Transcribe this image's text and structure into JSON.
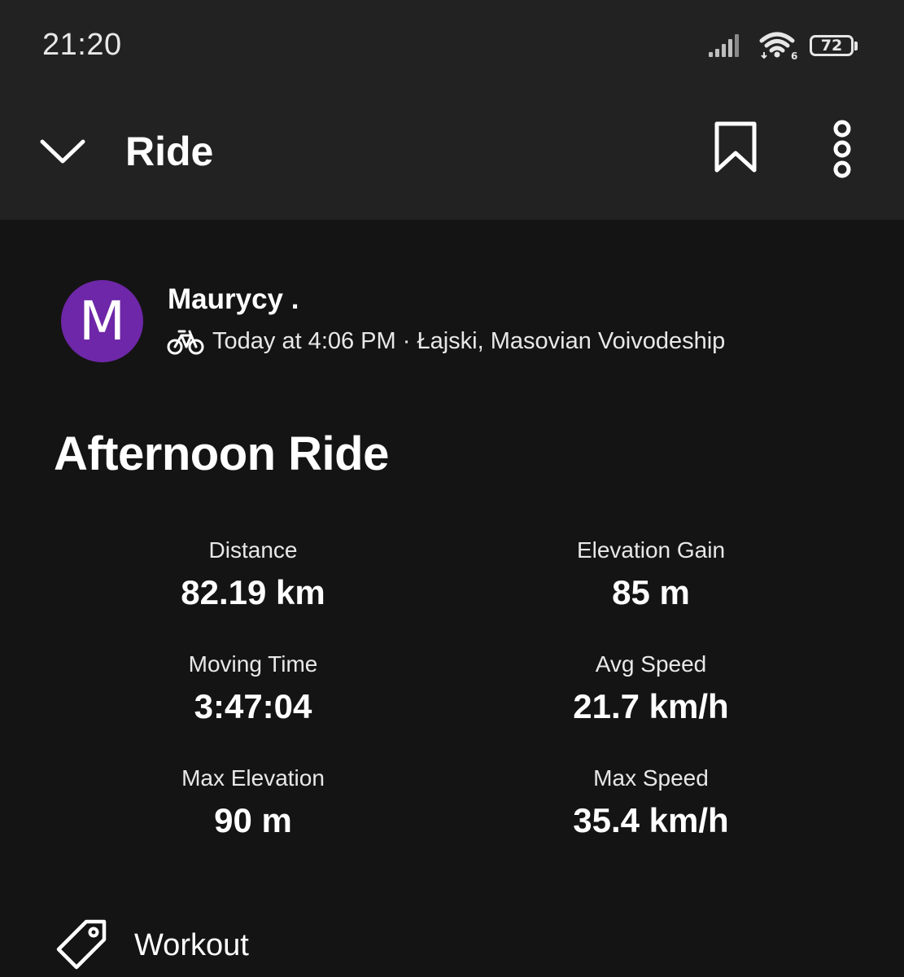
{
  "status_bar": {
    "time": "21:20",
    "battery": "72",
    "wifi_badge": "6"
  },
  "app_bar": {
    "title": "Ride"
  },
  "activity": {
    "athlete_initial": "M",
    "athlete_name": "Maurycy .",
    "meta": "Today at 4:06 PM · Łajski, Masovian Voivodeship",
    "sport_icon": "bike-icon",
    "title": "Afternoon Ride"
  },
  "stats": [
    {
      "label": "Distance",
      "value": "82.19 km"
    },
    {
      "label": "Elevation Gain",
      "value": "85 m"
    },
    {
      "label": "Moving Time",
      "value": "3:47:04"
    },
    {
      "label": "Avg Speed",
      "value": "21.7 km/h"
    },
    {
      "label": "Max Elevation",
      "value": "90 m"
    },
    {
      "label": "Max Speed",
      "value": "35.4 km/h"
    }
  ],
  "tag": {
    "icon": "tag-icon",
    "label": "Workout"
  },
  "colors": {
    "background": "#141414",
    "header": "#222222",
    "avatar": "#6e27a8",
    "text": "#ffffff"
  }
}
